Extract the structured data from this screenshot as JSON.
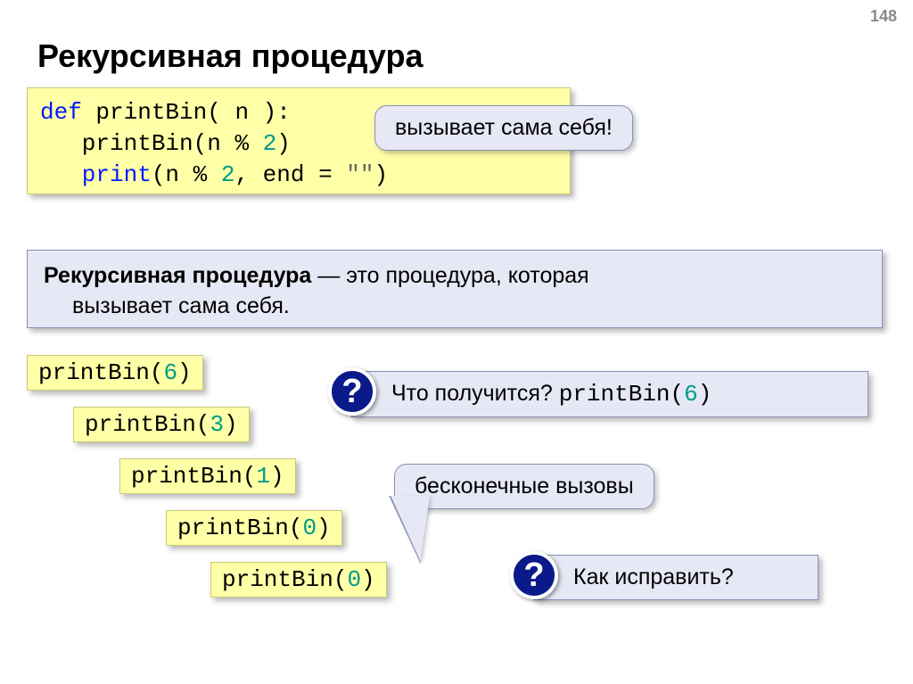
{
  "page_number": "148",
  "title": "Рекурсивная процедура",
  "code": {
    "kw_def": "def",
    "fn_name": " printBin( n ):",
    "l2a": "   printBin(n ",
    "l2_op": "%",
    "l2_num": " 2",
    "l2_end": ")",
    "l3a": "   print",
    "l3b": "(n ",
    "l3_op": "%",
    "l3_num": " 2",
    "l3c": ", end = ",
    "l3_str": "\"\"",
    "l3_end": ")"
  },
  "callout_self": "вызывает сама себя!",
  "definition": {
    "term": "Рекурсивная процедура",
    "text1": " — это процедура, которая",
    "text2": "вызывает сама себя."
  },
  "calls": [
    {
      "fn": "printBin(",
      "arg": "6",
      "close": ")"
    },
    {
      "fn": "printBin(",
      "arg": "3",
      "close": ")"
    },
    {
      "fn": "printBin(",
      "arg": "1",
      "close": ")"
    },
    {
      "fn": "printBin(",
      "arg": "0",
      "close": ")"
    },
    {
      "fn": "printBin(",
      "arg": "0",
      "close": ")"
    }
  ],
  "q_mark": "?",
  "question1": {
    "text": "Что получится? ",
    "code_fn": "printBin(",
    "code_arg": "6",
    "code_close": ")"
  },
  "bubble_inf": "бесконечные вызовы",
  "question2": "Как исправить?"
}
